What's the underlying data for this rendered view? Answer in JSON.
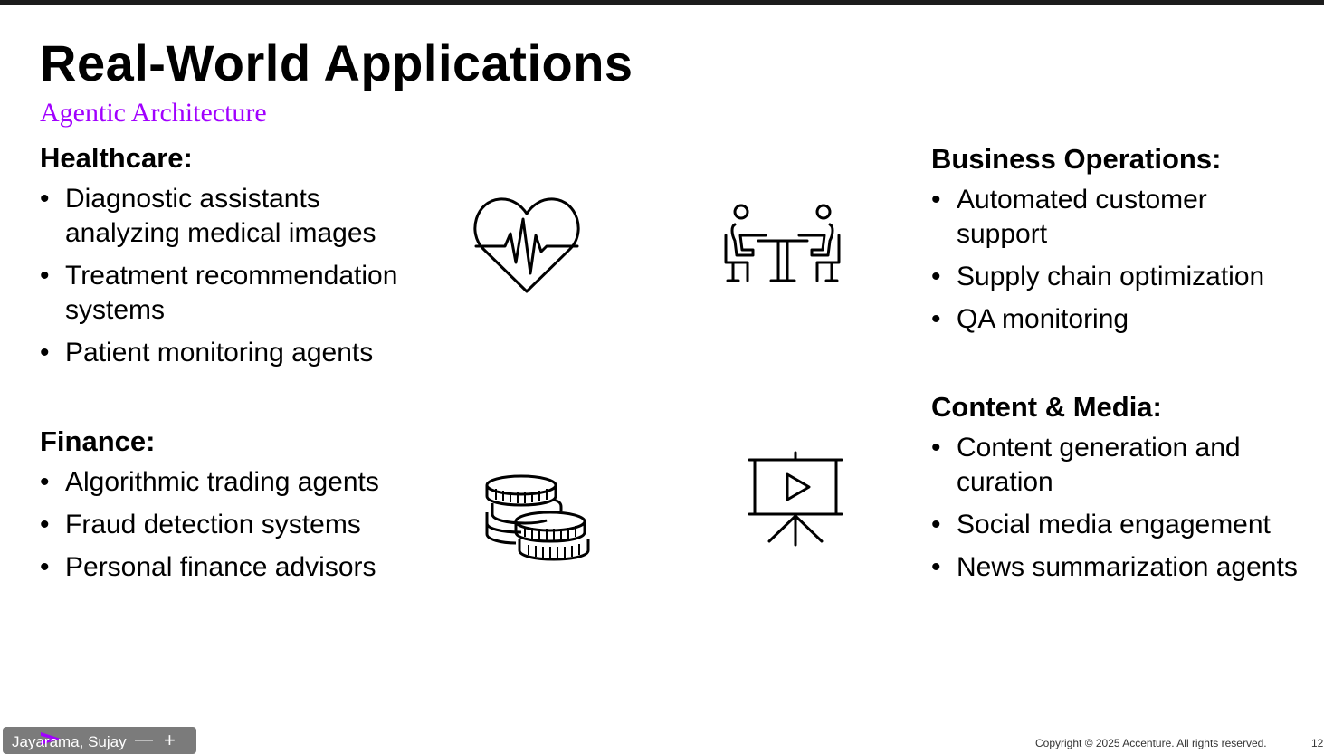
{
  "slide": {
    "title": "Real-World Applications",
    "subtitle": "Agentic Architecture",
    "accent_color": "#a100ff"
  },
  "sections": {
    "healthcare": {
      "heading": "Healthcare:",
      "items": [
        "Diagnostic assistants analyzing medical images",
        "Treatment recommendation systems",
        "Patient monitoring agents"
      ]
    },
    "finance": {
      "heading": "Finance:",
      "items": [
        "Algorithmic trading agents",
        "Fraud detection systems",
        "Personal finance advisors"
      ]
    },
    "business": {
      "heading": "Business Operations:",
      "items": [
        "Automated customer support",
        "Supply chain optimization",
        "QA monitoring"
      ]
    },
    "media": {
      "heading": "Content & Media:",
      "items": [
        "Content generation and curation",
        "Social media engagement",
        "News summarization agents"
      ]
    }
  },
  "icons": {
    "healthcare": "heartbeat-icon",
    "finance": "coins-icon",
    "business": "meeting-table-icon",
    "media": "presentation-video-icon"
  },
  "bullet_char": "•",
  "footer": {
    "presenter_name": "Jayarama, Sujay",
    "zoom_out": "—",
    "zoom_in": "+",
    "copyright": "Copyright © 2025 Accenture. All rights reserved.",
    "slide_number": "12"
  }
}
